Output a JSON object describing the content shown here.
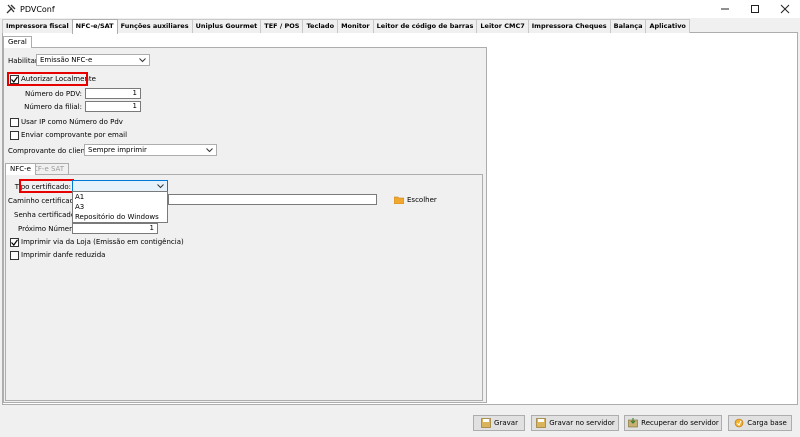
{
  "window": {
    "title": "PDVConf",
    "icon": "tools-icon"
  },
  "main_tabs": [
    {
      "label": "Impressora fiscal"
    },
    {
      "label": "NFC-e/SAT"
    },
    {
      "label": "Funções auxiliares"
    },
    {
      "label": "Uniplus Gourmet"
    },
    {
      "label": "TEF / POS"
    },
    {
      "label": "Teclado"
    },
    {
      "label": "Monitor"
    },
    {
      "label": "Leitor de código de barras"
    },
    {
      "label": "Leitor CMC7"
    },
    {
      "label": "Impressora Cheques"
    },
    {
      "label": "Balança"
    },
    {
      "label": "Aplicativo"
    }
  ],
  "geral": {
    "tab_label": "Geral",
    "habilitar_label": "Habilitar:",
    "habilitar_value": "Emissão NFC-e",
    "autorizar_label": "Autorizar Localmente",
    "numero_pdv_label": "Número do PDV:",
    "numero_pdv_value": "1",
    "numero_filial_label": "Número da filial:",
    "numero_filial_value": "1",
    "usar_ip_label": "Usar IP como Número do Pdv",
    "enviar_email_label": "Enviar comprovante por email",
    "comprovante_label": "Comprovante do cliente:",
    "comprovante_value": "Sempre imprimir"
  },
  "sub_tabs": {
    "nfce": "NFC-e",
    "cfesat": "CF-e SAT"
  },
  "nfce": {
    "tipo_certificado_label": "Tipo certificado:",
    "tipo_certificado_value": "",
    "dropdown_options": [
      "A1",
      "A3",
      "Repositório do Windows"
    ],
    "caminho_label": "Caminho certificado:",
    "escolher_label": "Escolher",
    "senha_label": "Senha certificado:",
    "proximo_label": "Próximo Número:",
    "proximo_value": "1",
    "imprimir_via_label": "Imprimir via da Loja (Emissão em contigência)",
    "imprimir_danfe_label": "Imprimir danfe reduzida"
  },
  "buttons": {
    "gravar": "Gravar",
    "gravar_servidor": "Gravar no servidor",
    "recuperar_servidor": "Recuperar do servidor",
    "carga_base": "Carga base"
  },
  "colors": {
    "highlight": "#e60000",
    "accent": "#0078d7"
  }
}
